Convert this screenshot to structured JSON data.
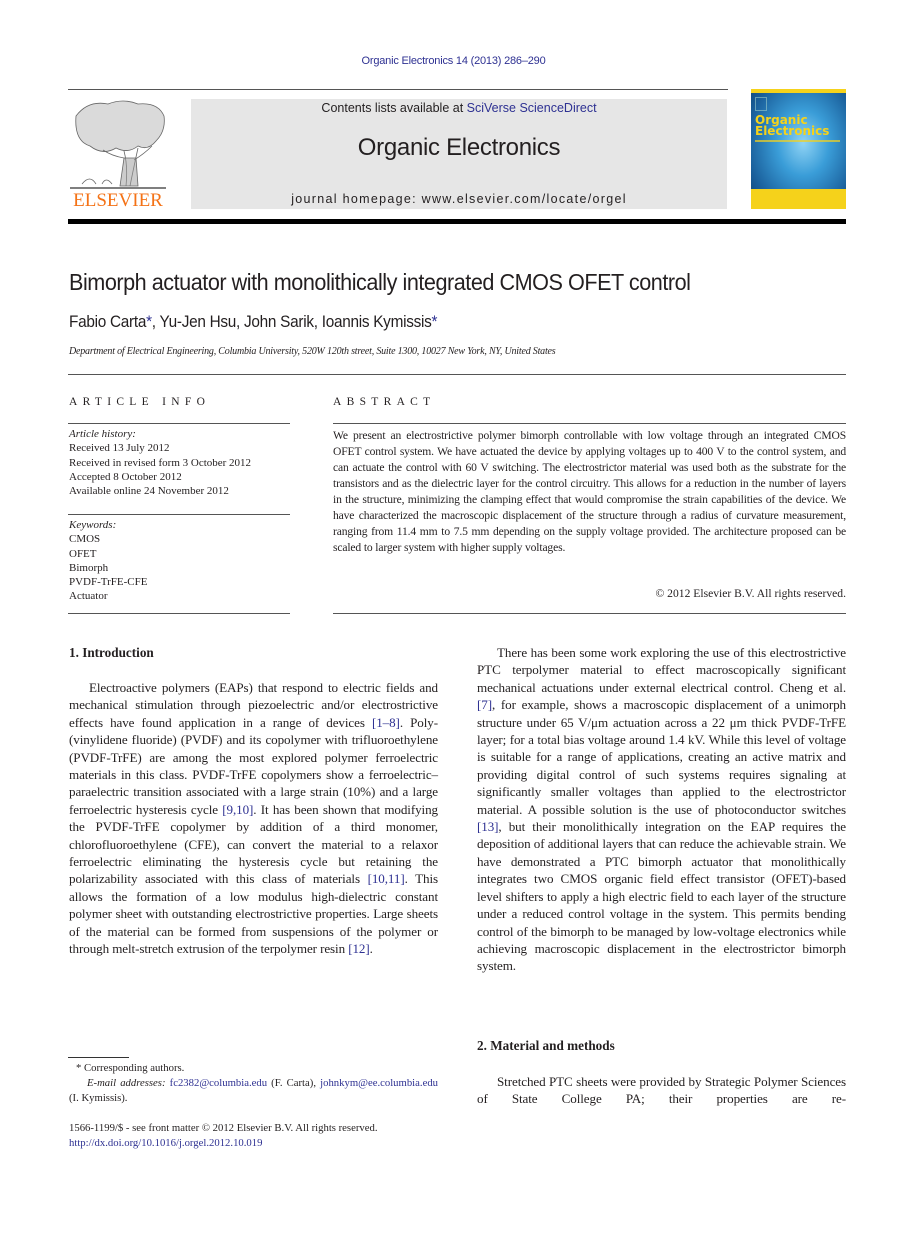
{
  "header": {
    "journal_ref": "Organic Electronics 14 (2013) 286–290",
    "contents_prefix": "Contents lists available at ",
    "contents_link": "SciVerse ScienceDirect",
    "journal_title": "Organic Electronics",
    "homepage": "journal homepage: www.elsevier.com/locate/orgel",
    "publisher_logo_text": "ELSEVIER",
    "cover_title_line1": "Organic",
    "cover_title_line2": "Electronics",
    "colors": {
      "publisher_orange": "#f47216",
      "link_blue": "#2e3192",
      "banner_gray": "#e6e6e6",
      "cover_yellow": "#f5d21b"
    }
  },
  "article": {
    "title": "Bimorph actuator with monolithically integrated CMOS OFET control",
    "authors": [
      {
        "name": "Fabio Carta",
        "corresponding": true
      },
      {
        "name": "Yu-Jen Hsu",
        "corresponding": false
      },
      {
        "name": "John Sarik",
        "corresponding": false
      },
      {
        "name": "Ioannis Kymissis",
        "corresponding": true
      }
    ],
    "star": "*",
    "sep": ", ",
    "affiliation": "Department of Electrical Engineering, Columbia University, 520W 120th street, Suite 1300, 10027 New York, NY, United States"
  },
  "article_info": {
    "label": "ARTICLE INFO",
    "history_heading": "Article history:",
    "history": [
      "Received 13 July 2012",
      "Received in revised form 3 October 2012",
      "Accepted 8 October 2012",
      "Available online 24 November 2012"
    ],
    "keywords_heading": "Keywords:",
    "keywords": [
      "CMOS",
      "OFET",
      "Bimorph",
      "PVDF-TrFE-CFE",
      "Actuator"
    ]
  },
  "abstract": {
    "label": "ABSTRACT",
    "text": "We present an electrostrictive polymer bimorph controllable with low voltage through an integrated CMOS OFET control system. We have actuated the device by applying voltages up to 400 V to the control system, and can actuate the control with 60 V switching. The electrostrictor material was used both as the substrate for the transistors and as the dielectric layer for the control circuitry. This allows for a reduction in the number of layers in the structure, minimizing the clamping effect that would compromise the strain capabilities of the device. We have characterized the macroscopic displacement of the structure through a radius of curvature measurement, ranging from 11.4 mm to 7.5 mm depending on the supply voltage provided. The architecture proposed can be scaled to larger system with higher supply voltages.",
    "copyright": "© 2012 Elsevier B.V. All rights reserved."
  },
  "body": {
    "section1_heading": "1. Introduction",
    "intro_p1": [
      {
        "t": "Electroactive polymers (EAPs) that respond to electric fields and mechanical stimulation through piezoelectric and/or electrostrictive effects have found application in a range of devices "
      },
      {
        "ref": "[1–8]"
      },
      {
        "t": ". Poly-(vinylidene fluoride) (PVDF) and its copolymer with trifluoroethylene (PVDF-TrFE) are among the most explored polymer ferroelectric materials in this class. PVDF-TrFE copolymers show a ferroelectric–paraelectric transition associated with a large strain (10%) and a large ferroelectric hysteresis cycle "
      },
      {
        "ref": "[9,10]"
      },
      {
        "t": ". It has been shown that modifying the PVDF-TrFE copolymer by addition of a third monomer, chlorofluoroethylene (CFE), can convert the material to a relaxor ferroelectric eliminating the hysteresis cycle but retaining the polarizability associated with this class of materials "
      },
      {
        "ref": "[10,11]"
      },
      {
        "t": ". This allows the formation of a low modulus high-dielectric constant polymer sheet with outstanding electrostrictive properties. Large sheets of the material can be formed from suspensions of the polymer or through melt-stretch extrusion of the terpolymer resin "
      },
      {
        "ref": "[12]"
      },
      {
        "t": "."
      }
    ],
    "intro_p2": [
      {
        "t": "There has been some work exploring the use of this electrostrictive PTC terpolymer material to effect macroscopically significant mechanical actuations under external electrical control. Cheng et al. "
      },
      {
        "ref": "[7]"
      },
      {
        "t": ", for example, shows a macroscopic displacement of a unimorph structure under 65 V/μm actuation across a 22 μm thick PVDF-TrFE layer; for a total bias voltage around 1.4 kV. While this level of voltage is suitable for a range of applications, creating an active matrix and providing digital control of such systems requires signaling at significantly smaller voltages than applied to the electrostrictor material. A possible solution is the use of photoconductor switches "
      },
      {
        "ref": "[13]"
      },
      {
        "t": ", but their monolithically integration on the EAP requires the deposition of additional layers that can reduce the achievable strain. We have demonstrated a PTC bimorph actuator that monolithically integrates two CMOS organic field effect transistor (OFET)-based level shifters to apply a high electric field to each layer of the structure under a reduced control voltage in the system. This permits bending control of the bimorph to be managed by low-voltage electronics while achieving macroscopic displacement in the electrostrictor bimorph system."
      }
    ],
    "section2_heading": "2. Material and methods",
    "methods_p1": "Stretched PTC sheets were provided by Strategic Polymer Sciences of State College PA; their properties are re-"
  },
  "footnotes": {
    "corresponding": "* Corresponding authors.",
    "email_label": "E-mail addresses: ",
    "email1": "fc2382@columbia.edu",
    "email1_owner": " (F. Carta), ",
    "email2": "johnkym@ee.columbia.edu",
    "email2_owner": " (I. Kymissis).",
    "issn": "1566-1199/$ - see front matter © 2012 Elsevier B.V. All rights reserved.",
    "doi": "http://dx.doi.org/10.1016/j.orgel.2012.10.019"
  }
}
